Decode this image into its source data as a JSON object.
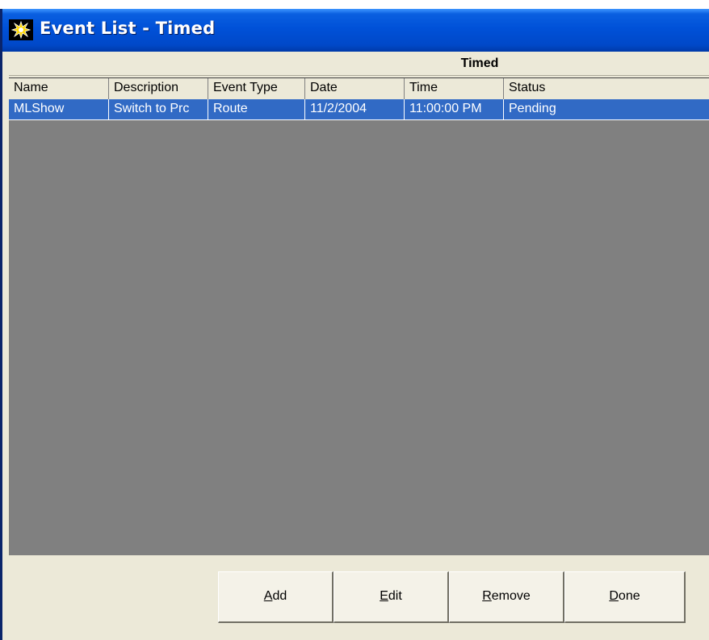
{
  "window": {
    "title": "Event List - Timed",
    "icon": "starburst-icon"
  },
  "group": {
    "label": "Timed"
  },
  "table": {
    "columns": [
      "Name",
      "Description",
      "Event Type",
      "Date",
      "Time",
      "Status"
    ],
    "rows": [
      [
        "MLShow",
        "Switch to Prc",
        "Route",
        "11/2/2004",
        "11:00:00 PM",
        "Pending"
      ]
    ],
    "selected_row": 0
  },
  "buttons": {
    "add": {
      "mnemonic": "A",
      "rest": "dd"
    },
    "edit": {
      "mnemonic": "E",
      "rest": "dit"
    },
    "remove": {
      "mnemonic": "R",
      "rest": "emove"
    },
    "done": {
      "mnemonic": "D",
      "rest": "one"
    }
  },
  "colors": {
    "titlebar": "#0051d8",
    "selection": "#316ac5",
    "grid_background": "#808080",
    "face": "#ece9d8"
  }
}
